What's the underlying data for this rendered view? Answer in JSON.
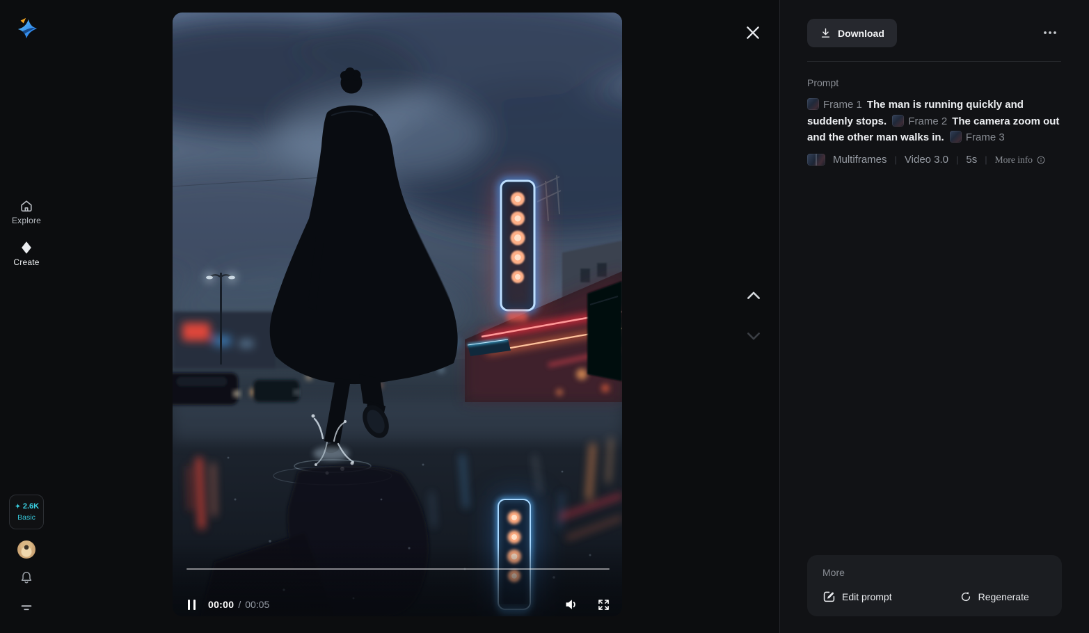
{
  "sidebar": {
    "explore_label": "Explore",
    "create_label": "Create",
    "credits_amount": "2.6K",
    "plan": "Basic"
  },
  "player": {
    "time_current": "00:00",
    "time_separator": "/",
    "time_total": "00:05"
  },
  "panel": {
    "download_label": "Download",
    "prompt_label": "Prompt",
    "frames": [
      {
        "tag": "Frame 1",
        "text": "The man is running quickly and suddenly stops."
      },
      {
        "tag": "Frame 2",
        "text": "The camera zoom out and the other man walks in."
      },
      {
        "tag": "Frame 3",
        "text": ""
      }
    ],
    "meta": {
      "mode": "Multiframes",
      "model": "Video 3.0",
      "duration": "5s",
      "more_info": "More info",
      "separator": "|"
    },
    "more": {
      "title": "More",
      "edit_label": "Edit prompt",
      "regenerate_label": "Regenerate"
    }
  },
  "icons": [
    "logo",
    "home-icon",
    "diamond-icon",
    "sparkle-icon",
    "bell-icon",
    "menu-icon",
    "close-icon",
    "chevron-up-icon",
    "chevron-down-icon",
    "download-icon",
    "ellipsis-icon",
    "info-icon",
    "pause-icon",
    "volume-icon",
    "fullscreen-icon",
    "edit-icon",
    "regenerate-icon"
  ],
  "colors": {
    "page_bg": "#111215",
    "stage_bg": "#0c0d0f",
    "accent_cyan": "#3ad2e4",
    "neon_red": "#ff4a3a",
    "neon_blue": "#5fb8ff",
    "card_bg": "#1b1d21",
    "button_bg": "#26282e"
  }
}
